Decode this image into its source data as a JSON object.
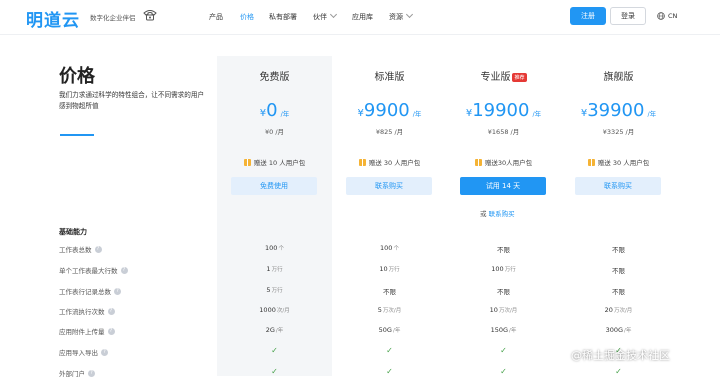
{
  "header": {
    "logo": "明道云",
    "slogan": "数字化企业伴侣",
    "phone_icon": "phone-icon",
    "nav": [
      {
        "label": "产品",
        "dropdown": false,
        "active": false
      },
      {
        "label": "价格",
        "dropdown": false,
        "active": true
      },
      {
        "label": "私有部署",
        "dropdown": false,
        "active": false
      },
      {
        "label": "伙伴",
        "dropdown": true,
        "active": false
      },
      {
        "label": "应用库",
        "dropdown": false,
        "active": false
      },
      {
        "label": "资源",
        "dropdown": true,
        "active": false
      }
    ],
    "register": "注册",
    "login": "登录",
    "language": "CN",
    "globe_icon": "globe-icon"
  },
  "intro": {
    "title": "价格",
    "description": "我们力求通过科学的特性组合，让不同需求的用户感到物超所值"
  },
  "plans": [
    {
      "name": "免费版",
      "badge": "",
      "currency": "¥",
      "price": "0",
      "unit": "/年",
      "monthly": "¥0 /月",
      "gift": "赠送 10 人用户包",
      "button": "免费使用",
      "primary": false
    },
    {
      "name": "标准版",
      "badge": "",
      "currency": "¥",
      "price": "9900",
      "unit": "/年",
      "monthly": "¥825 /月",
      "gift": "赠送 30 人用户包",
      "button": "联系购买",
      "primary": false
    },
    {
      "name": "专业版",
      "badge": "推荐",
      "currency": "¥",
      "price": "19900",
      "unit": "/年",
      "monthly": "¥1658 /月",
      "gift": "赠送30人用户包",
      "button": "试用 14 天",
      "primary": true
    },
    {
      "name": "旗舰版",
      "badge": "",
      "currency": "¥",
      "price": "39900",
      "unit": "/年",
      "monthly": "¥3325 /月",
      "gift": "赠送 30 人用户包",
      "button": "联系购买",
      "primary": false
    }
  ],
  "alt_action": {
    "prefix": "或",
    "link": "联系购买"
  },
  "features": {
    "section": "基础能力",
    "rows": [
      {
        "label": "工作表总数",
        "help": true,
        "values": [
          {
            "v": "100",
            "u": "个"
          },
          {
            "v": "100",
            "u": "个"
          },
          {
            "v": "不限",
            "u": ""
          },
          {
            "v": "不限",
            "u": ""
          }
        ]
      },
      {
        "label": "单个工作表最大行数",
        "help": true,
        "values": [
          {
            "v": "1",
            "u": "万行"
          },
          {
            "v": "10",
            "u": "万行"
          },
          {
            "v": "100",
            "u": "万行"
          },
          {
            "v": "不限",
            "u": ""
          }
        ]
      },
      {
        "label": "工作表行记录总数",
        "help": true,
        "values": [
          {
            "v": "5",
            "u": "万行"
          },
          {
            "v": "不限",
            "u": ""
          },
          {
            "v": "不限",
            "u": ""
          },
          {
            "v": "不限",
            "u": ""
          }
        ]
      },
      {
        "label": "工作流执行次数",
        "help": true,
        "values": [
          {
            "v": "1000",
            "u": "次/月"
          },
          {
            "v": "5",
            "u": "万次/月"
          },
          {
            "v": "10",
            "u": "万次/月"
          },
          {
            "v": "20",
            "u": "万次/月"
          }
        ]
      },
      {
        "label": "应用附件上传量",
        "help": true,
        "values": [
          {
            "v": "2G",
            "u": "/年"
          },
          {
            "v": "50G",
            "u": "/年"
          },
          {
            "v": "150G",
            "u": "/年"
          },
          {
            "v": "300G",
            "u": "/年"
          }
        ]
      },
      {
        "label": "应用导入导出",
        "help": true,
        "values": [
          {
            "v": "✓",
            "u": ""
          },
          {
            "v": "✓",
            "u": ""
          },
          {
            "v": "✓",
            "u": ""
          },
          {
            "v": "✓",
            "u": ""
          }
        ]
      },
      {
        "label": "外部门户",
        "help": true,
        "values": [
          {
            "v": "✓",
            "u": ""
          },
          {
            "v": "✓",
            "u": ""
          },
          {
            "v": "✓",
            "u": ""
          },
          {
            "v": "✓",
            "u": ""
          }
        ]
      }
    ]
  },
  "watermark": "@稀土掘金技术社区",
  "colors": {
    "accent": "#2196f3",
    "badge": "#e53935",
    "check": "#43a047",
    "gift": "#f5b335"
  }
}
